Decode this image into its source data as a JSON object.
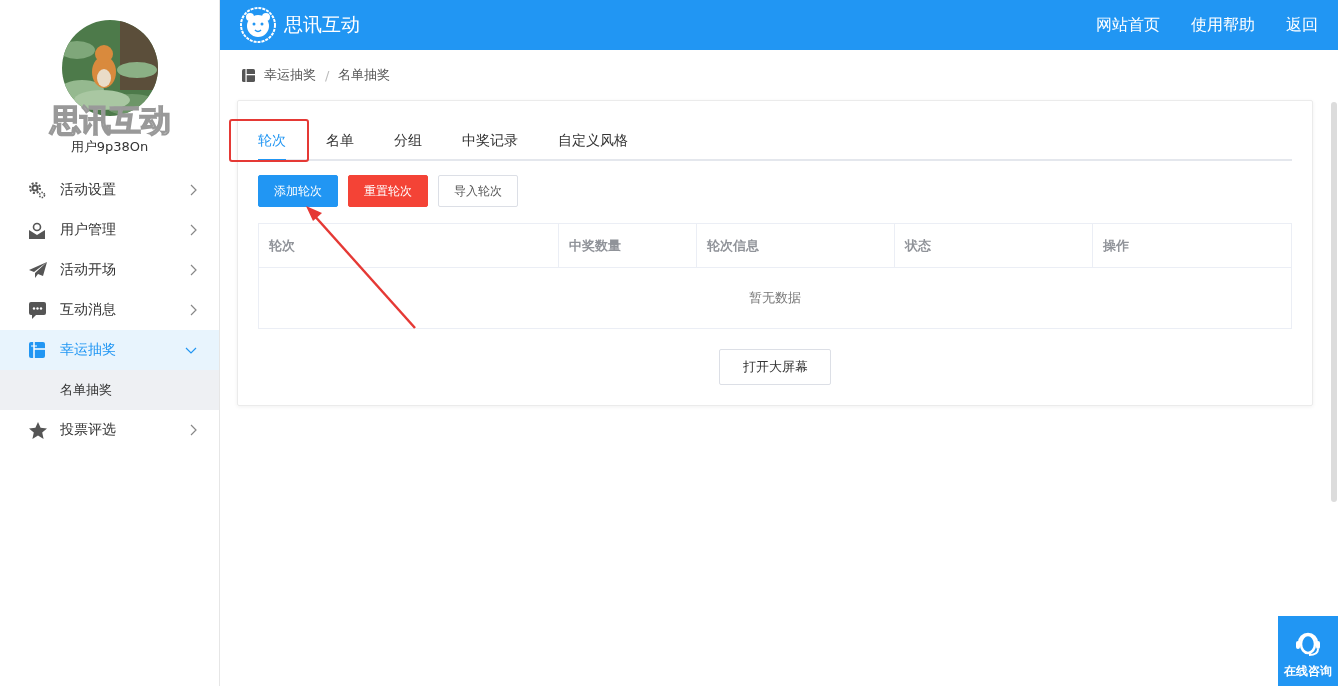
{
  "sidebar": {
    "logo_text": "思讯互动",
    "username": "用户9p38On",
    "items": [
      {
        "label": "活动设置",
        "expanded": false,
        "selected": false
      },
      {
        "label": "用户管理",
        "expanded": false,
        "selected": false
      },
      {
        "label": "活动开场",
        "expanded": false,
        "selected": false
      },
      {
        "label": "互动消息",
        "expanded": false,
        "selected": false
      },
      {
        "label": "幸运抽奖",
        "expanded": true,
        "selected": true,
        "children": [
          {
            "label": "名单抽奖",
            "selected": true
          }
        ]
      },
      {
        "label": "投票评选",
        "expanded": false,
        "selected": false
      }
    ]
  },
  "header": {
    "brand": "思讯互动",
    "links": [
      "网站首页",
      "使用帮助",
      "返回"
    ]
  },
  "breadcrumb": {
    "items": [
      "幸运抽奖",
      "名单抽奖"
    ],
    "separator": "/"
  },
  "tabs": [
    {
      "label": "轮次",
      "selected": true
    },
    {
      "label": "名单",
      "selected": false
    },
    {
      "label": "分组",
      "selected": false
    },
    {
      "label": "中奖记录",
      "selected": false
    },
    {
      "label": "自定义风格",
      "selected": false
    }
  ],
  "buttons": [
    {
      "label": "添加轮次",
      "kind": "primary"
    },
    {
      "label": "重置轮次",
      "kind": "danger"
    },
    {
      "label": "导入轮次",
      "kind": "default"
    }
  ],
  "table": {
    "columns": [
      "轮次",
      "中奖数量",
      "轮次信息",
      "状态",
      "操作"
    ],
    "empty_text": "暂无数据"
  },
  "screen_button": "打开大屏幕",
  "consult_button": "在线咨询"
}
